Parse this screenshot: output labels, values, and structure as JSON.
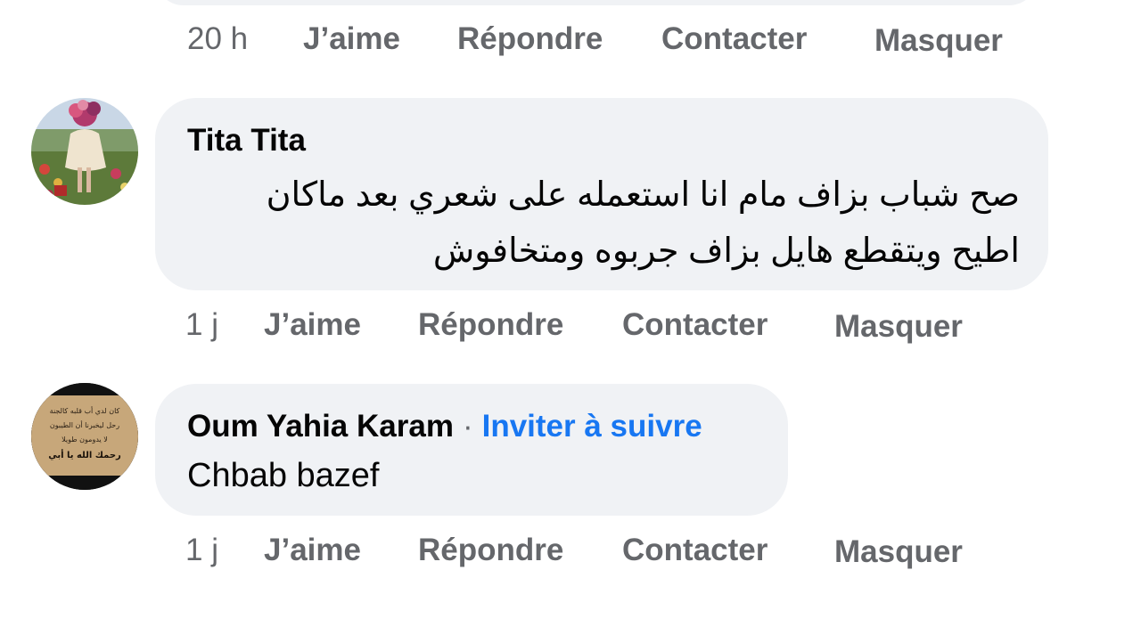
{
  "previous_comment": {
    "actions": {
      "time": "20 h",
      "like": "J’aime",
      "reply": "Répondre",
      "contact": "Contacter",
      "hide": "Masquer"
    }
  },
  "comments": [
    {
      "author": "Tita Tita",
      "text_line1": "صح  شباب بزاف مام انا استعمله على شعري بعد ماكان",
      "text_line2": "اطيح ويتقطع هايل بزاف جربوه ومتخافوش",
      "actions": {
        "time": "1 j",
        "like": "J’aime",
        "reply": "Répondre",
        "contact": "Contacter",
        "hide": "Masquer"
      }
    },
    {
      "author": "Oum Yahia Karam",
      "separator": "·",
      "invite": "Inviter à suivre",
      "text": "Chbab bazef",
      "avatar_text": {
        "line1": "كان لدي أب قلبه كالجنة",
        "line2": "رحل ليخبرنا أن الطيبون",
        "line3": "لا يدومون طويلا",
        "line4": "رحمك الله يا أبي"
      },
      "actions": {
        "time": "1 j",
        "like": "J’aime",
        "reply": "Répondre",
        "contact": "Contacter",
        "hide": "Masquer"
      }
    }
  ],
  "colors": {
    "bubble": "#f0f2f5",
    "secondary_text": "#65676b",
    "link_blue": "#1877f2"
  }
}
